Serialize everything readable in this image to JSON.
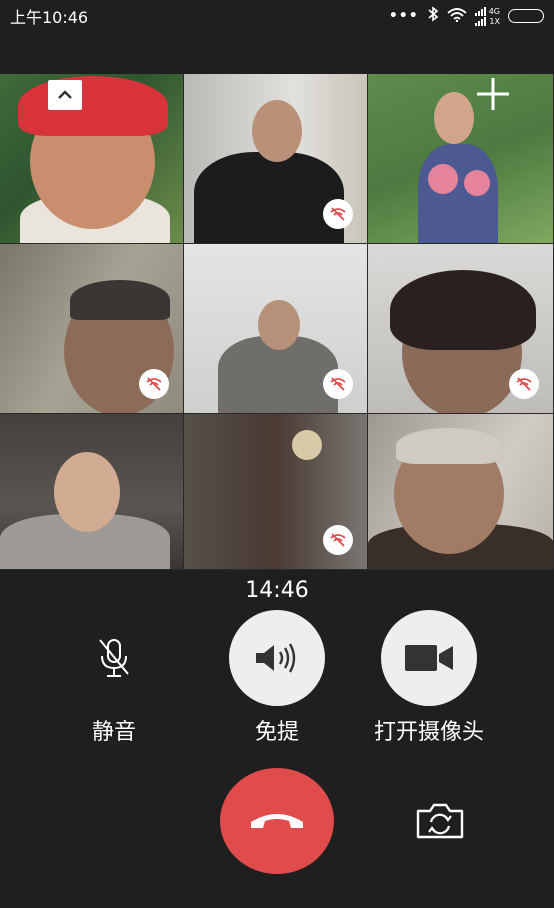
{
  "status_bar": {
    "time": "上午10:46",
    "dots": "•••",
    "network_label_top": "4G",
    "network_label_bottom": "1X",
    "icons": [
      "more-dots-icon",
      "bluetooth-icon",
      "wifi-icon",
      "signal-icon",
      "battery-icon"
    ]
  },
  "video_grid": {
    "tiles": [
      {
        "id": "participant-1",
        "weak_signal": false
      },
      {
        "id": "participant-2",
        "weak_signal": true
      },
      {
        "id": "participant-3",
        "weak_signal": false
      },
      {
        "id": "participant-4",
        "weak_signal": true
      },
      {
        "id": "participant-5",
        "weak_signal": true
      },
      {
        "id": "participant-6",
        "weak_signal": true
      },
      {
        "id": "participant-7",
        "weak_signal": false
      },
      {
        "id": "participant-8",
        "weak_signal": true
      },
      {
        "id": "participant-9",
        "weak_signal": false
      }
    ],
    "collapse_icon": "chevron-up-icon",
    "add_icon": "plus-icon"
  },
  "call": {
    "timer": "14:46"
  },
  "controls": {
    "mute_label": "静音",
    "speaker_label": "免提",
    "camera_label": "打开摄像头"
  },
  "colors": {
    "background": "#1f1f1f",
    "hangup": "#e04b4b",
    "button_fill": "#eeeeee"
  }
}
